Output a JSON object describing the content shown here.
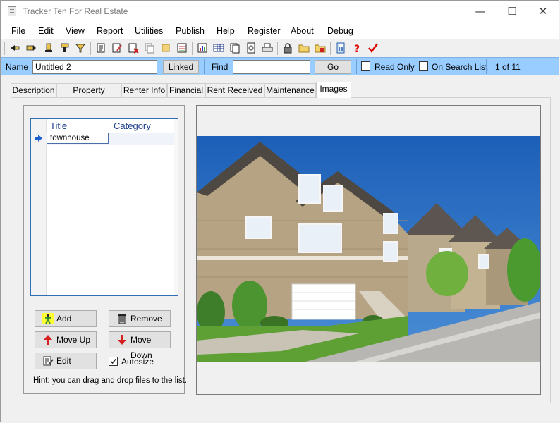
{
  "window": {
    "title": "Tracker Ten For Real Estate",
    "minimize": "—",
    "maximize": "☐",
    "close": "✕"
  },
  "menu": [
    "File",
    "Edit",
    "View",
    "Report",
    "Utilities",
    "Publish",
    "Help",
    "Register",
    "About",
    "Debug"
  ],
  "toolbar": {
    "icons": [
      "first-record-icon",
      "previous-record-icon",
      "next-record-icon",
      "last-record-icon",
      "filter-icon",
      "new-record-icon",
      "edit-record-icon",
      "delete-record-icon",
      "copy-record-icon",
      "clear-icon",
      "save-icon",
      "report-icon",
      "table-icon",
      "copy-icon",
      "print-preview-icon",
      "print-icon",
      "lock-icon",
      "open-folder-icon",
      "import-icon",
      "calculator-icon",
      "help-icon",
      "checkmark-icon"
    ]
  },
  "searchbar": {
    "name_label": "Name",
    "name_value": "Untitled 2",
    "linked_button": "Linked",
    "find_label": "Find",
    "find_value": "",
    "go_button": "Go",
    "read_only_label": "Read Only",
    "read_only_checked": false,
    "on_search_list_label": "On Search List",
    "on_search_list_checked": false,
    "record_position": "1 of 11"
  },
  "tabs": [
    "Description",
    "Property Address",
    "Renter Info",
    "Financial",
    "Rent Received",
    "Maintenance",
    "Images"
  ],
  "active_tab": "Images",
  "images_tab": {
    "grid": {
      "columns": [
        "Title",
        "Category"
      ],
      "rows": [
        {
          "title": "townhouse",
          "category": ""
        }
      ]
    },
    "buttons": {
      "add": "Add",
      "remove": "Remove",
      "move_up": "Move Up",
      "move_down": "Move Down",
      "edit": "Edit"
    },
    "autosize_label": "Autosize",
    "autosize_checked": true,
    "hint": "Hint: you can drag and drop files to the list."
  },
  "colors": {
    "searchbar_bg": "#99ccff",
    "grid_header": "#1e3f8a",
    "accent_blue": "#2f6fb8"
  }
}
